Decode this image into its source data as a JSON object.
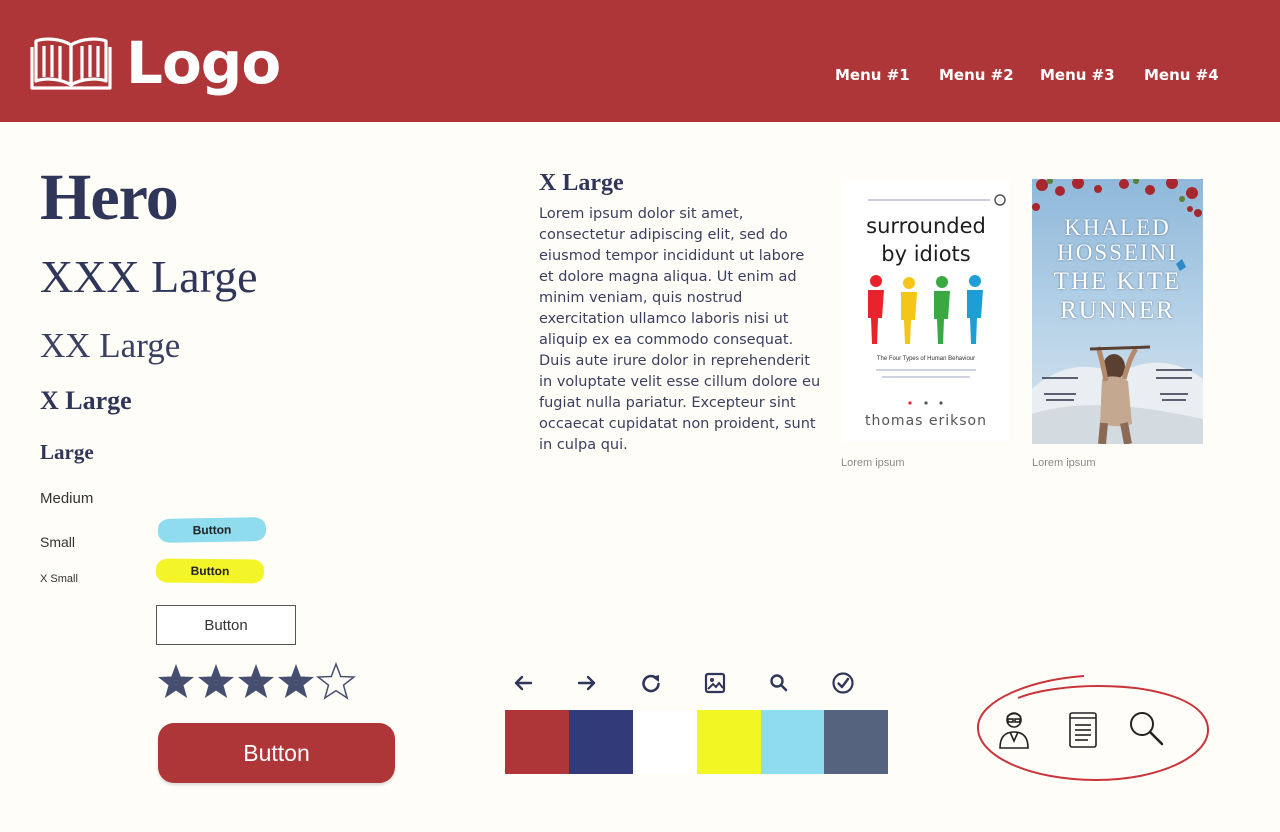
{
  "header": {
    "logo_text": "Logo",
    "menu": [
      "Menu #1",
      "Menu #2",
      "Menu #3",
      "Menu #4"
    ],
    "background": "#ae3538"
  },
  "type_scale": {
    "hero": "Hero",
    "xxx_large": "XXX Large",
    "xx_large": "XX Large",
    "x_large": "X Large",
    "large": "Large",
    "medium": "Medium",
    "small": "Small",
    "x_small": "X Small"
  },
  "buttons": {
    "brush_blue": "Button",
    "brush_yellow": "Button",
    "outline": "Button",
    "primary": "Button"
  },
  "rating": {
    "value": 4,
    "max": 5
  },
  "article": {
    "title": "X Large",
    "body": "Lorem ipsum dolor sit amet, consectetur adipiscing elit, sed do eiusmod tempor incididunt ut labore et dolore magna aliqua. Ut enim ad minim veniam, quis nostrud exercitation ullamco laboris nisi ut aliquip ex ea commodo consequat. Duis aute irure dolor in reprehenderit in voluptate velit esse cillum dolore eu fugiat nulla pariatur. Excepteur sint occaecat cupidatat non proident, sunt in culpa qui."
  },
  "books": [
    {
      "title_line1": "surrounded",
      "title_line2": "by idiots",
      "subtitle": "The Four Types of Human Behaviour",
      "author": "thomas erikson",
      "caption": "Lorem ipsum"
    },
    {
      "author_line1": "KHALED",
      "author_line2": "HOSSEINI",
      "title_line1": "THE KITE",
      "title_line2": "RUNNER",
      "caption": "Lorem ipsum"
    }
  ],
  "icons": [
    "arrow-left-icon",
    "arrow-right-icon",
    "refresh-icon",
    "image-icon",
    "search-icon",
    "check-circle-icon"
  ],
  "palette": [
    "#ae3538",
    "#323a78",
    "#ffffff",
    "#f2f724",
    "#8fdcef",
    "#55637f"
  ],
  "circled_icons": [
    "user-icon",
    "document-icon",
    "search-icon"
  ]
}
